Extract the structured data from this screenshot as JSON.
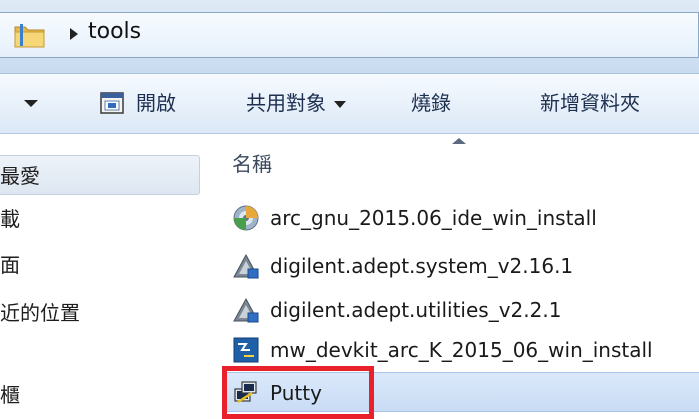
{
  "address": {
    "path_segment": "tools"
  },
  "toolbar": {
    "open_label": "開啟",
    "share_label": "共用對象",
    "burn_label": "燒錄",
    "new_folder_label": "新增資料夾"
  },
  "nav": {
    "items": [
      {
        "label": "最愛",
        "selected": true
      },
      {
        "label": "載"
      },
      {
        "label": "面"
      },
      {
        "label": "近的位置"
      },
      {
        "label": ""
      },
      {
        "label": "櫃"
      }
    ]
  },
  "file_list": {
    "column_name": "名稱",
    "files": [
      {
        "name": "arc_gnu_2015.06_ide_win_install",
        "icon": "installer-disc-icon"
      },
      {
        "name": "digilent.adept.system_v2.16.1",
        "icon": "setup-triangle-icon"
      },
      {
        "name": "digilent.adept.utilities_v2.2.1",
        "icon": "setup-triangle-icon"
      },
      {
        "name": "mw_devkit_arc_K_2015_06_win_install",
        "icon": "blue-app-icon"
      },
      {
        "name": "Putty",
        "icon": "putty-icon",
        "selected": true,
        "highlighted": true
      }
    ]
  },
  "colors": {
    "highlight": "#e8212b",
    "selection": "#cfe0f6"
  }
}
